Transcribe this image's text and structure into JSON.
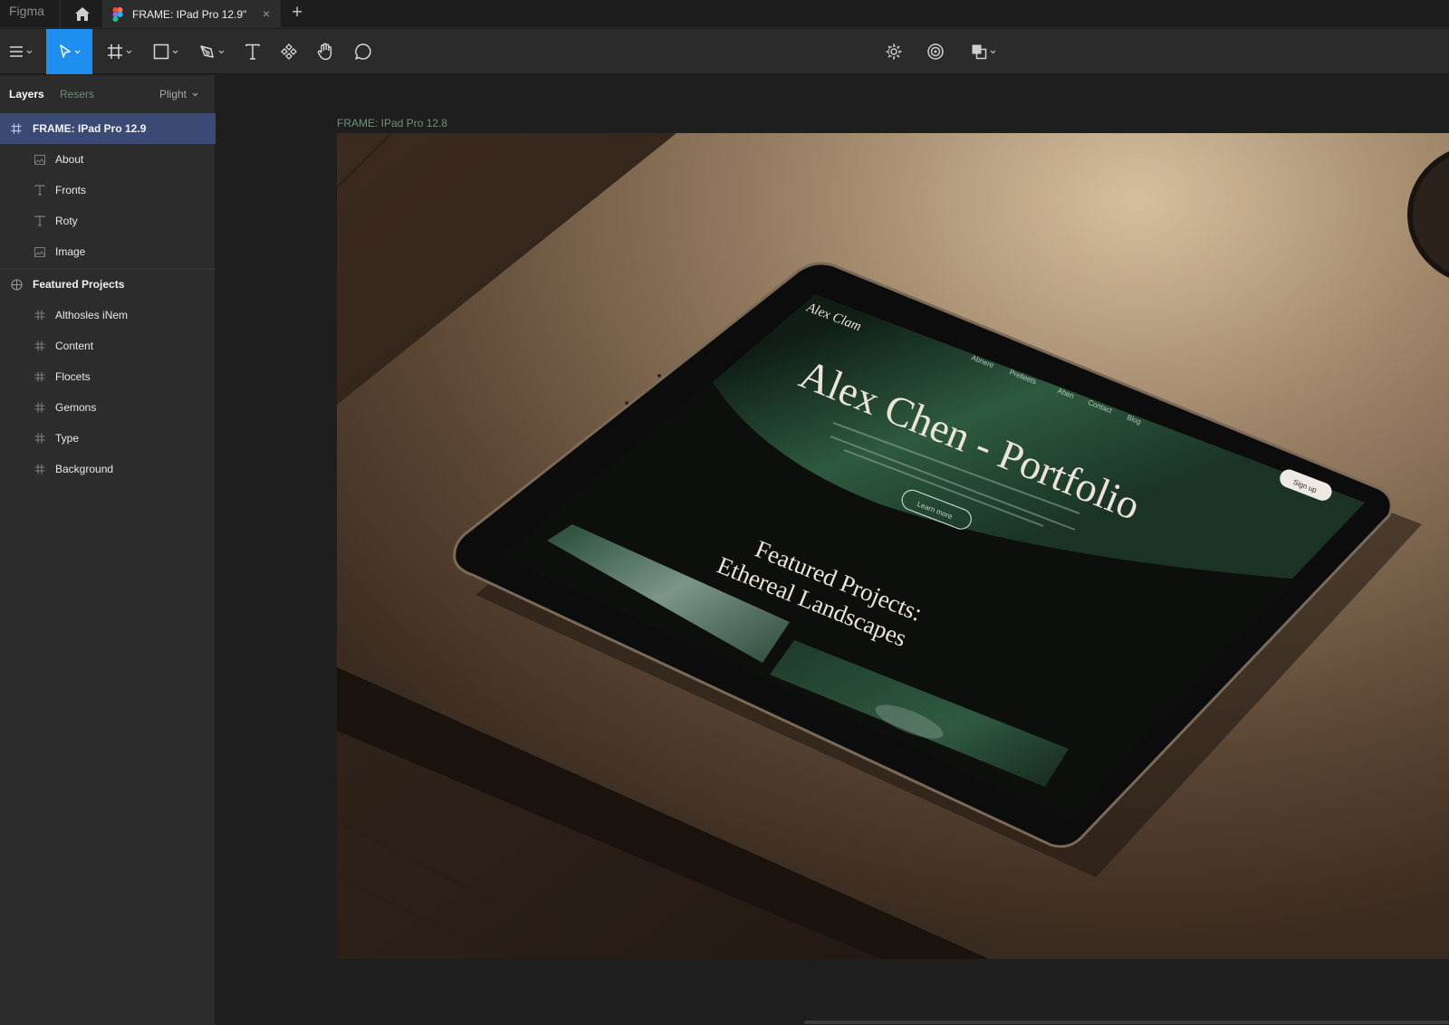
{
  "app": {
    "name": "Figma"
  },
  "tabs": {
    "document_title": "FRAME: IPad Pro 12.9\"",
    "close_glyph": "×",
    "new_tab_glyph": "+"
  },
  "toolbar": {
    "tools": [
      {
        "name": "main-menu",
        "icon": "hamburger-icon"
      },
      {
        "name": "move-tool",
        "icon": "cursor-icon",
        "active": true
      },
      {
        "name": "frame-tool",
        "icon": "frame-icon"
      },
      {
        "name": "shape-tool",
        "icon": "rectangle-icon"
      },
      {
        "name": "pen-tool",
        "icon": "pen-icon"
      },
      {
        "name": "text-tool",
        "icon": "text-icon"
      },
      {
        "name": "components-tool",
        "icon": "components-icon"
      },
      {
        "name": "hand-tool",
        "icon": "hand-icon"
      },
      {
        "name": "comment-tool",
        "icon": "comment-icon"
      },
      {
        "name": "plugins",
        "icon": "gear-icon"
      },
      {
        "name": "resources",
        "icon": "target-icon"
      },
      {
        "name": "share",
        "icon": "share-icon"
      }
    ],
    "accent_color": "#1f8ef1"
  },
  "left_panel": {
    "tabs": {
      "layers": "Layers",
      "assets": "Resers",
      "page": "Plight"
    },
    "layers": [
      {
        "label": "FRAME: IPad Pro 12.9",
        "type": "frame",
        "level": 0,
        "selected": true
      },
      {
        "label": "About",
        "type": "image",
        "level": 1
      },
      {
        "label": "Fronts",
        "type": "text",
        "level": 1
      },
      {
        "label": "Roty",
        "type": "text",
        "level": 1
      },
      {
        "label": "Image",
        "type": "image",
        "level": 1
      },
      {
        "label": "Featured Projects",
        "type": "component",
        "level": 0
      },
      {
        "label": "Althosles iNem",
        "type": "frame",
        "level": 1
      },
      {
        "label": "Content",
        "type": "frame",
        "level": 1
      },
      {
        "label": "Flocets",
        "type": "frame",
        "level": 1
      },
      {
        "label": "Gemons",
        "type": "frame",
        "level": 1
      },
      {
        "label": "Type",
        "type": "frame",
        "level": 1
      },
      {
        "label": "Background",
        "type": "frame",
        "level": 1
      }
    ],
    "selection_color": "#3a4a74"
  },
  "canvas": {
    "frame_label": "FRAME: IPad Pro 12.8",
    "artwork": {
      "site_logo": "Alex Clam",
      "nav_items": [
        "Abnere",
        "Prelleets",
        "Ahen",
        "Contact",
        "Blog"
      ],
      "headline": "Alex Chen - Portfolio",
      "cta_primary": "Sign up",
      "cta_secondary": "Learn more",
      "section_title_line1": "Featured Projects:",
      "section_title_line2": "Ethereal Landscapes"
    }
  }
}
